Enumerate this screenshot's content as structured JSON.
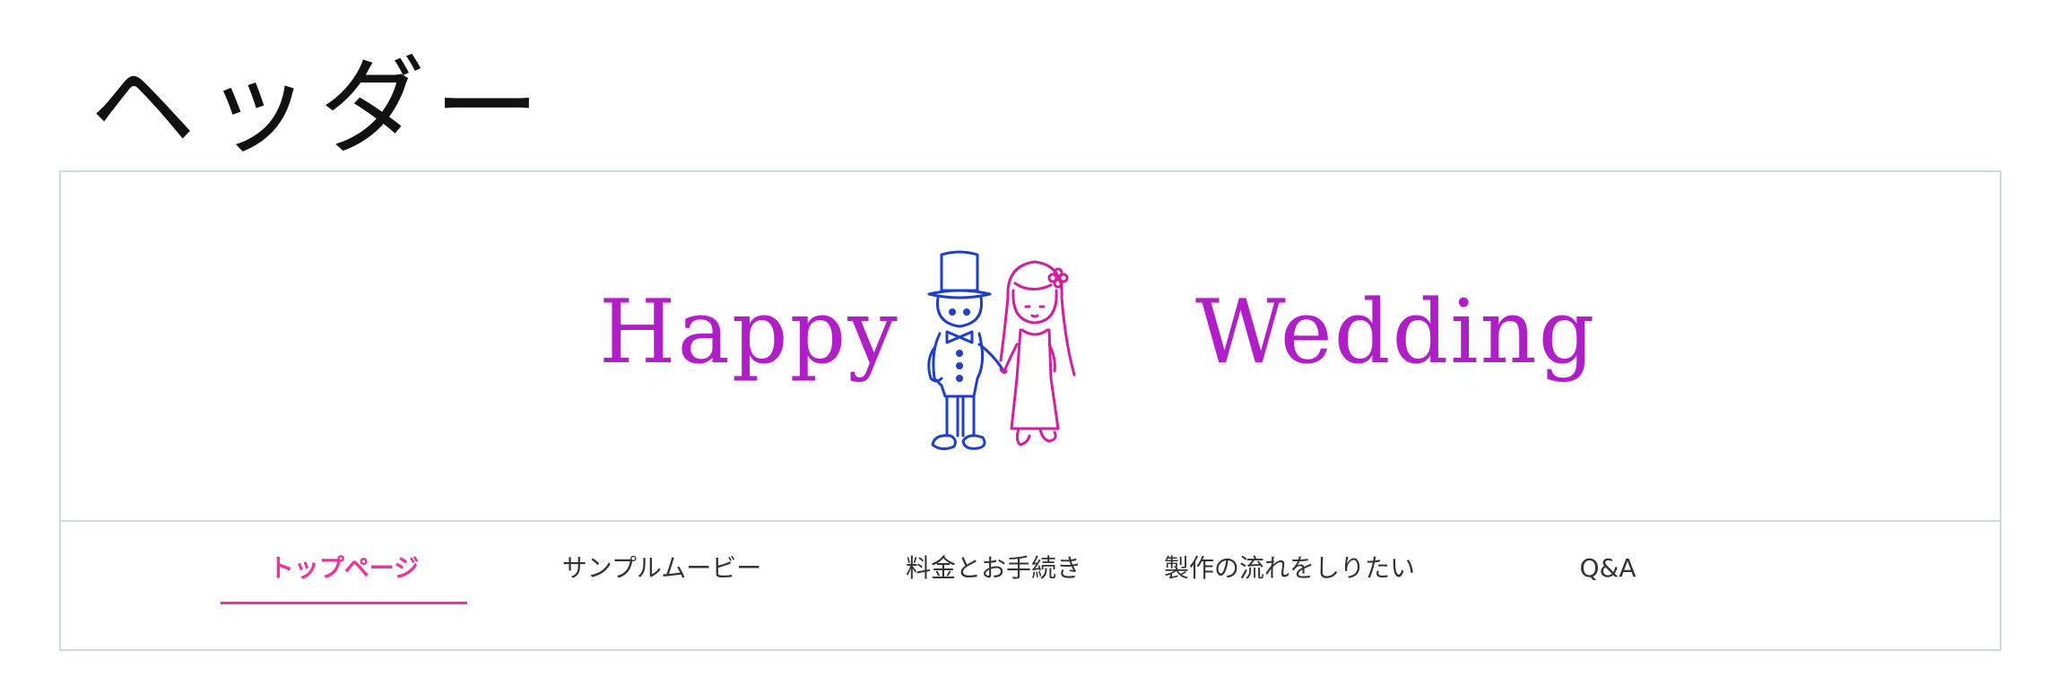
{
  "page_title": "ヘッダー",
  "logo": {
    "word_left": "Happy",
    "word_right": "Wedding",
    "illustration_icon": "bride-and-groom-icon"
  },
  "nav": {
    "items": [
      {
        "label": "トップページ",
        "active": true
      },
      {
        "label": "サンプルムービー",
        "active": false
      },
      {
        "label": "料金とお手続き",
        "active": false
      },
      {
        "label": "製作の流れをしりたい",
        "active": false
      },
      {
        "label": "Q&A",
        "active": false
      }
    ]
  },
  "colors": {
    "brand": "#b01ec8",
    "accent": "#f0329b",
    "groom": "#1f3fc8",
    "bride": "#d21ea0"
  }
}
